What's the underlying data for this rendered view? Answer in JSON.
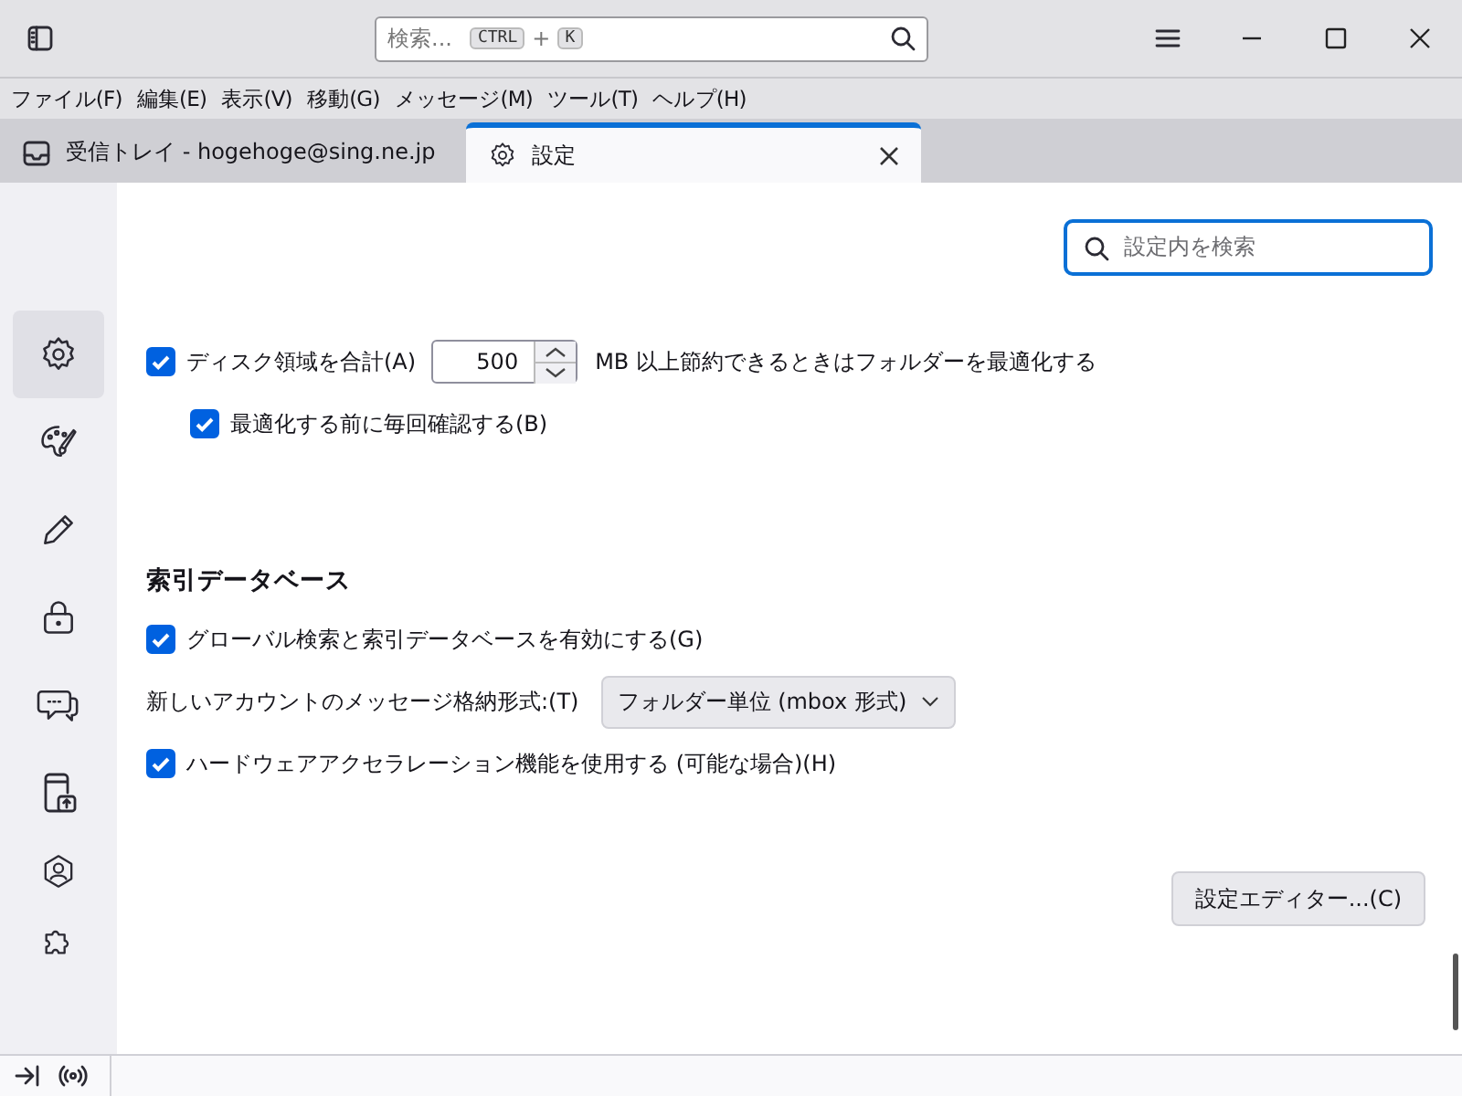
{
  "toolbar": {
    "search": {
      "placeholder": "検索...",
      "keys": [
        "CTRL",
        "K"
      ],
      "joiner": "+"
    }
  },
  "menu": [
    "ファイル(F)",
    "編集(E)",
    "表示(V)",
    "移動(G)",
    "メッセージ(M)",
    "ツール(T)",
    "ヘルプ(H)"
  ],
  "tabs": [
    {
      "label": "受信トレイ - hogehoge@sing.ne.jp",
      "kind": "inbox",
      "selected": false
    },
    {
      "label": "設定",
      "kind": "settings",
      "selected": true
    }
  ],
  "sidebar": [
    {
      "kind": "gear",
      "selected": true
    },
    {
      "kind": "palette",
      "selected": false
    },
    {
      "kind": "pencil",
      "selected": false
    },
    {
      "kind": "lock",
      "selected": false
    },
    {
      "kind": "chat",
      "selected": false
    },
    {
      "kind": "device",
      "selected": false
    },
    {
      "kind": "account",
      "selected": false
    },
    {
      "kind": "puzzle",
      "selected": false
    }
  ],
  "settings_search": {
    "placeholder": "設定内を検索"
  },
  "settings": [
    {
      "kind": "checkbox_number",
      "label": "ディスク領域を合計(A)",
      "value": "500",
      "after": "MB 以上節約できるときはフォルダーを最適化する",
      "checked": true,
      "indent": false
    },
    {
      "kind": "checkbox",
      "label": "最適化する前に毎回確認する(B)",
      "checked": true,
      "indent": true
    },
    {
      "kind": "heading",
      "label": "索引データベース"
    },
    {
      "kind": "checkbox",
      "label": "グローバル検索と索引データベースを有効にする(G)",
      "checked": true,
      "indent": false
    },
    {
      "kind": "select",
      "label": "新しいアカウントのメッセージ格納形式:(T)",
      "value": "フォルダー単位 (mbox 形式)"
    },
    {
      "kind": "checkbox",
      "label": "ハードウェアアクセラレーション機能を使用する (可能な場合)(H)",
      "checked": true,
      "indent": false
    },
    {
      "kind": "button",
      "label": "設定エディター...(C)"
    }
  ]
}
